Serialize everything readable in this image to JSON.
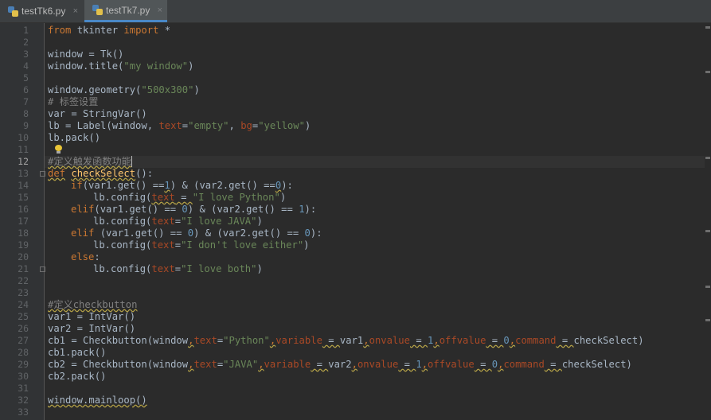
{
  "tabs": [
    {
      "label": "testTk6.py",
      "close": "×"
    },
    {
      "label": "testTk7.py",
      "close": "×"
    }
  ],
  "line_numbers": [
    "1",
    "2",
    "3",
    "4",
    "5",
    "6",
    "7",
    "8",
    "9",
    "10",
    "11",
    "12",
    "13",
    "14",
    "15",
    "16",
    "17",
    "18",
    "19",
    "20",
    "21",
    "22",
    "23",
    "24",
    "25",
    "26",
    "27",
    "28",
    "29",
    "30",
    "31",
    "32",
    "33"
  ],
  "code": {
    "l1": {
      "a": "from",
      "b": " tkinter ",
      "c": "import",
      "d": " *"
    },
    "l3": {
      "a": "window = Tk()"
    },
    "l4": {
      "a": "window.title(",
      "b": "\"my window\"",
      "c": ")"
    },
    "l6": {
      "a": "window.geometry(",
      "b": "\"500x300\"",
      "c": ")"
    },
    "l7": {
      "a": "# 标签设置"
    },
    "l8": {
      "a": "var = StringVar()"
    },
    "l9": {
      "a": "lb = Label(window, ",
      "b": "text",
      "c": "=",
      "d": "\"empty\"",
      "e": ", ",
      "f": "bg",
      "g": "=",
      "h": "\"yellow\"",
      "i": ")"
    },
    "l10": {
      "a": "lb.pack()"
    },
    "l12": {
      "a": "#定义触发函数功能"
    },
    "l13": {
      "a": "def",
      "b": " ",
      "c": "checkSelect",
      "d": "():"
    },
    "l14": {
      "a": "if",
      "b": "(var1.get() ==",
      "c": "1",
      "d": ") & (var2.get() ==",
      "e": "0",
      "f": "):"
    },
    "l15": {
      "a": "lb.config(",
      "b": "text",
      "c": " = ",
      "d": "\"I love Python\"",
      "e": ")"
    },
    "l16": {
      "a": "elif",
      "b": "(var1.get() == ",
      "c": "0",
      "d": ") & (var2.get() == ",
      "e": "1",
      "f": "):"
    },
    "l17": {
      "a": "lb.config(",
      "b": "text",
      "c": "=",
      "d": "\"I love JAVA\"",
      "e": ")"
    },
    "l18": {
      "a": "elif",
      "b": " (var1.get() == ",
      "c": "0",
      "d": ") & (var2.get() == ",
      "e": "0",
      "f": "):"
    },
    "l19": {
      "a": "lb.config(",
      "b": "text",
      "c": "=",
      "d": "\"I don't love either\"",
      "e": ")"
    },
    "l20": {
      "a": "else",
      "b": ":"
    },
    "l21": {
      "a": "lb.config(",
      "b": "text",
      "c": "=",
      "d": "\"I love both\"",
      "e": ")"
    },
    "l24": {
      "a": "#定义checkbutton"
    },
    "l25": {
      "a": "var1 = IntVar()"
    },
    "l26": {
      "a": "var2 = IntVar()"
    },
    "l27": {
      "a": "cb1 = Checkbutton(window",
      "b": ",",
      "c": "text",
      "d": "=",
      "e": "\"Python\"",
      "f": ",",
      "g": "variable",
      "h": " = ",
      "i": "var1",
      "j": ",",
      "k": "onvalue",
      "l": " = ",
      "m": "1",
      "n": ",",
      "o": "offvalue",
      "p": " = ",
      "q": "0",
      "r": ",",
      "s": "command",
      "t": " = ",
      "u": "checkSelect)"
    },
    "l28": {
      "a": "cb1.pack()"
    },
    "l29": {
      "a": "cb2 = Checkbutton(window",
      "b": ",",
      "c": "text",
      "d": "=",
      "e": "\"JAVA\"",
      "f": ",",
      "g": "variable",
      "h": " = ",
      "i": "var2",
      "j": ",",
      "k": "onvalue",
      "l": " = ",
      "m": "1",
      "n": ",",
      "o": "offvalue",
      "p": " = ",
      "q": "0",
      "r": ",",
      "s": "command",
      "t": " = ",
      "u": "checkSelect)"
    },
    "l30": {
      "a": "cb2.pack()"
    },
    "l32": {
      "a": "window.mainloop()"
    }
  },
  "colors": {
    "background": "#2b2b2b",
    "keyword": "#cc7832",
    "string": "#6a8759",
    "number": "#6897bb",
    "comment": "#808080",
    "parameter": "#aa4926",
    "function": "#ffc66d",
    "text": "#a9b7c6"
  },
  "current_line": "12",
  "icons": [
    "python-file-icon",
    "close-icon",
    "lightbulb-icon",
    "fold-icon"
  ]
}
